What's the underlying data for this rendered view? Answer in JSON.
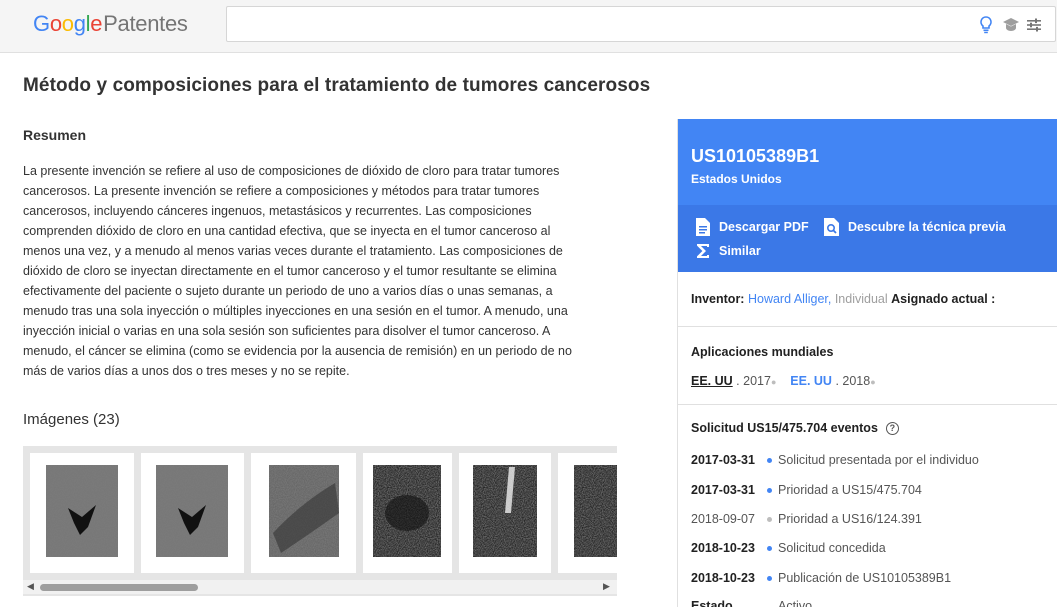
{
  "header": {
    "logo_google": [
      "G",
      "o",
      "o",
      "g",
      "l",
      "e"
    ],
    "logo_product": "Patentes",
    "search_value": ""
  },
  "patent": {
    "title": "Método y composiciones para el tratamiento de tumores cancerosos",
    "abstract_heading": "Resumen",
    "abstract_lines": [
      "La presente invención se refiere al uso de composiciones de dióxido de cloro para tratar tumores",
      "cancerosos. La presente invención se refiere a composiciones y métodos para tratar tumores",
      "cancerosos, incluyendo cánceres ingenuos, metastásicos y recurrentes. Las composiciones",
      "comprenden dióxido de cloro en una cantidad efectiva, que se inyecta en el tumor canceroso al",
      "menos una vez, y a menudo al menos varias veces durante el tratamiento. Las composiciones de",
      "dióxido de cloro se inyectan directamente en el tumor canceroso y el tumor resultante se elimina",
      "efectivamente del paciente o sujeto durante un periodo de uno a varios días o unas semanas, a",
      "menudo tras una sola inyección o múltiples inyecciones en una sesión en el tumor. A menudo, una",
      "inyección inicial o varias en una sola sesión son suficientes para disolver el tumor canceroso. A",
      "menudo, el cáncer se elimina (como se evidencia por la ausencia de remisión) en un periodo de no",
      "más de varios días a unos dos o tres meses y no se repite."
    ],
    "images_heading": "Imágenes (23)"
  },
  "panel": {
    "publication_number": "US10105389B1",
    "country": "Estados Unidos",
    "actions": {
      "download_pdf": "Descargar PDF",
      "prior_art": "Descubre la técnica previa",
      "similar": "Similar"
    },
    "inventor_label": "Inventor:",
    "inventor_name": "Howard Alliger,",
    "inventor_type": "Individual",
    "assignee_label": "Asignado actual :",
    "worldwide_title": "Aplicaciones mundiales",
    "worldwide": [
      {
        "country": "EE. UU",
        "year": ". 2017"
      },
      {
        "country": "EE. UU",
        "year": ". 2018"
      }
    ],
    "events_title": "Solicitud US15/475.704 eventos",
    "events": [
      {
        "date": "2017-03-31",
        "desc": "Solicitud presentada por el individuo"
      },
      {
        "date": "2017-03-31",
        "desc": "Prioridad a US15/475.704"
      },
      {
        "date": "2018-09-07",
        "desc": "Prioridad a US16/124.391"
      },
      {
        "date": "2018-10-23",
        "desc": "Solicitud concedida"
      },
      {
        "date": "2018-10-23",
        "desc": "Publicación de US10105389B1"
      },
      {
        "date": "Estado",
        "desc": "Activo"
      }
    ]
  }
}
